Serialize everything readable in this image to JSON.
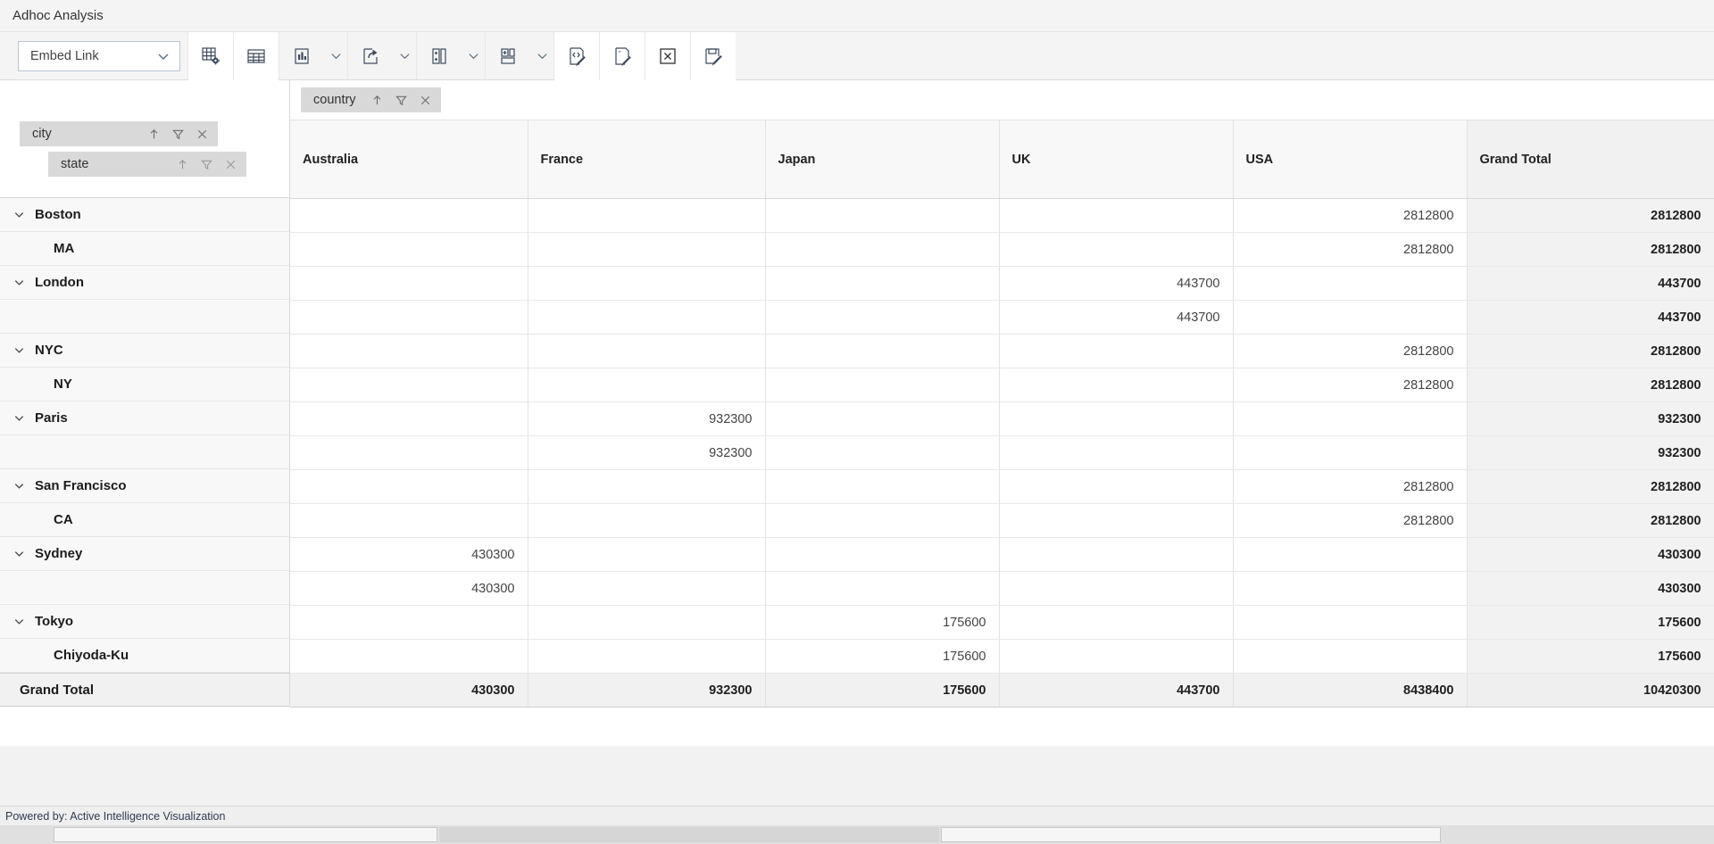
{
  "window": {
    "title": "Adhoc Analysis"
  },
  "toolbar": {
    "embed_select": {
      "value": "Embed Link",
      "icon": "chevron-down-icon"
    },
    "buttons": [
      {
        "name": "grid-settings-button",
        "icon": "grid-gear-icon",
        "caret": false
      },
      {
        "name": "table-view-button",
        "icon": "table-icon",
        "caret": false
      },
      {
        "name": "chart-type-button",
        "icon": "bar-chart-icon",
        "caret": true
      },
      {
        "name": "export-share-button",
        "icon": "share-export-icon",
        "caret": true
      },
      {
        "name": "add-column-button",
        "icon": "add-column-icon",
        "caret": true
      },
      {
        "name": "add-row-button",
        "icon": "add-row-icon",
        "caret": true
      },
      {
        "name": "edit-expression-button",
        "icon": "code-edit-icon",
        "caret": false
      },
      {
        "name": "edit-text-button",
        "icon": "text-edit-icon",
        "caret": false
      },
      {
        "name": "export-excel-button",
        "icon": "excel-x-icon",
        "caret": false
      },
      {
        "name": "save-report-button",
        "icon": "save-edit-icon",
        "caret": false
      }
    ]
  },
  "fields": {
    "column_chip": {
      "label": "country",
      "sort_icon": "sort-asc-icon",
      "filter_icon": "filter-icon",
      "remove_icon": "close-icon"
    },
    "row_chips": [
      {
        "label": "city",
        "sort_icon": "sort-asc-icon",
        "filter_icon": "filter-icon",
        "remove_icon": "close-icon"
      },
      {
        "label": "state",
        "sort_icon": "sort-asc-icon",
        "filter_icon": "filter-icon",
        "remove_icon": "close-icon"
      }
    ]
  },
  "pivot": {
    "columns": [
      "Australia",
      "France",
      "Japan",
      "UK",
      "USA",
      "Grand Total"
    ],
    "rows": [
      {
        "label": "Boston",
        "level": 1,
        "expanded": true,
        "values": [
          "",
          "",
          "",
          "",
          "2812800",
          "2812800"
        ]
      },
      {
        "label": "MA",
        "level": 2,
        "expanded": false,
        "values": [
          "",
          "",
          "",
          "",
          "2812800",
          "2812800"
        ]
      },
      {
        "label": "London",
        "level": 1,
        "expanded": true,
        "values": [
          "",
          "",
          "",
          "443700",
          "",
          "443700"
        ]
      },
      {
        "label": "",
        "level": 2,
        "expanded": false,
        "values": [
          "",
          "",
          "",
          "443700",
          "",
          "443700"
        ]
      },
      {
        "label": "NYC",
        "level": 1,
        "expanded": true,
        "values": [
          "",
          "",
          "",
          "",
          "2812800",
          "2812800"
        ]
      },
      {
        "label": "NY",
        "level": 2,
        "expanded": false,
        "values": [
          "",
          "",
          "",
          "",
          "2812800",
          "2812800"
        ]
      },
      {
        "label": "Paris",
        "level": 1,
        "expanded": true,
        "values": [
          "",
          "932300",
          "",
          "",
          "",
          "932300"
        ]
      },
      {
        "label": "",
        "level": 2,
        "expanded": false,
        "values": [
          "",
          "932300",
          "",
          "",
          "",
          "932300"
        ]
      },
      {
        "label": "San Francisco",
        "level": 1,
        "expanded": true,
        "values": [
          "",
          "",
          "",
          "",
          "2812800",
          "2812800"
        ]
      },
      {
        "label": "CA",
        "level": 2,
        "expanded": false,
        "values": [
          "",
          "",
          "",
          "",
          "2812800",
          "2812800"
        ]
      },
      {
        "label": "Sydney",
        "level": 1,
        "expanded": true,
        "values": [
          "430300",
          "",
          "",
          "",
          "",
          "430300"
        ]
      },
      {
        "label": "",
        "level": 2,
        "expanded": false,
        "values": [
          "430300",
          "",
          "",
          "",
          "",
          "430300"
        ]
      },
      {
        "label": "Tokyo",
        "level": 1,
        "expanded": true,
        "values": [
          "",
          "",
          "175600",
          "",
          "",
          "175600"
        ]
      },
      {
        "label": "Chiyoda-Ku",
        "level": 2,
        "expanded": false,
        "values": [
          "",
          "",
          "175600",
          "",
          "",
          "175600"
        ]
      }
    ],
    "grand_total": {
      "label": "Grand Total",
      "values": [
        "430300",
        "932300",
        "175600",
        "443700",
        "8438400",
        "10420300"
      ]
    }
  },
  "footer": {
    "powered_by": "Powered by: Active Intelligence Visualization"
  },
  "colors": {
    "toolbar_bg": "#f4f4f4",
    "chip_bg": "#d9d9d9",
    "grand_total_bg": "#f2f2f2",
    "row_header_bg": "#f8f8f8",
    "icon_stroke": "#5a6b80"
  }
}
